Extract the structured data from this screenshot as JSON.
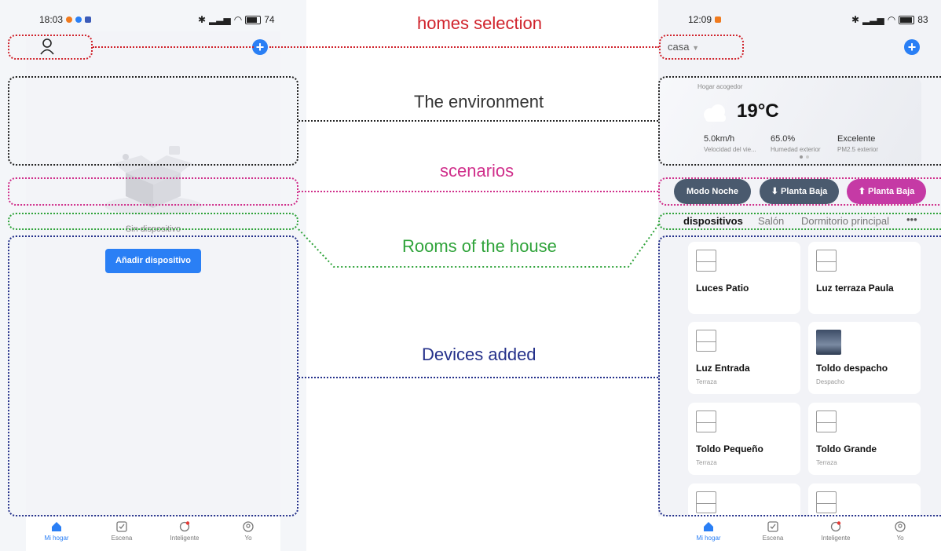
{
  "left_phone": {
    "time": "18:03",
    "battery": "74",
    "empty_text": "Sin dispositivo",
    "add_button": "Añadir dispositivo",
    "nav": [
      "Mi hogar",
      "Escena",
      "Inteligente",
      "Yo"
    ]
  },
  "right_phone": {
    "time": "12:09",
    "battery": "83",
    "home_selector": "casa",
    "weather": {
      "caption": "Hogar acogedor",
      "temperature": "19°C",
      "wind_value": "5.0km/h",
      "wind_label": "Velocidad del vie...",
      "humidity_value": "65.0%",
      "humidity_label": "Humedad exterior",
      "pm_value": "Excelente",
      "pm_label": "PM2.5 exterior"
    },
    "scenes": [
      "Modo Noche",
      "Planta Baja",
      "Planta Baja"
    ],
    "rooms": [
      "dispositivos",
      "Salón",
      "Dormitorio principal"
    ],
    "rooms_more": "•••",
    "devices": [
      {
        "name": "Luces Patio",
        "room": ""
      },
      {
        "name": "Luz terraza Paula",
        "room": ""
      },
      {
        "name": "Luz Entrada",
        "room": "Terraza"
      },
      {
        "name": "Toldo despacho",
        "room": "Despacho"
      },
      {
        "name": "Toldo Pequeño",
        "room": "Terraza"
      },
      {
        "name": "Toldo Grande",
        "room": "Terraza"
      }
    ],
    "nav": [
      "Mi hogar",
      "Escena",
      "Inteligente",
      "Yo"
    ]
  },
  "annotations": {
    "homes": "homes selection",
    "environment": "The environment",
    "scenarios": "scenarios",
    "rooms": "Rooms of the house",
    "devices": "Devices added"
  },
  "colors": {
    "accent_blue": "#2a7ff5",
    "homes": "#d0232c",
    "environment": "#222222",
    "scenarios": "#d02f8b",
    "rooms": "#2fa33a",
    "devices": "#24308a",
    "scene_pill_dark": "#4a5a6e",
    "scene_pill_pink": "#c53aa5"
  },
  "icons": [
    "person-icon",
    "plus-icon",
    "home-icon",
    "scene-icon",
    "smart-icon",
    "profile-icon",
    "cloud-icon",
    "blind-icon",
    "bluetooth-icon",
    "wifi-icon",
    "battery-icon"
  ]
}
